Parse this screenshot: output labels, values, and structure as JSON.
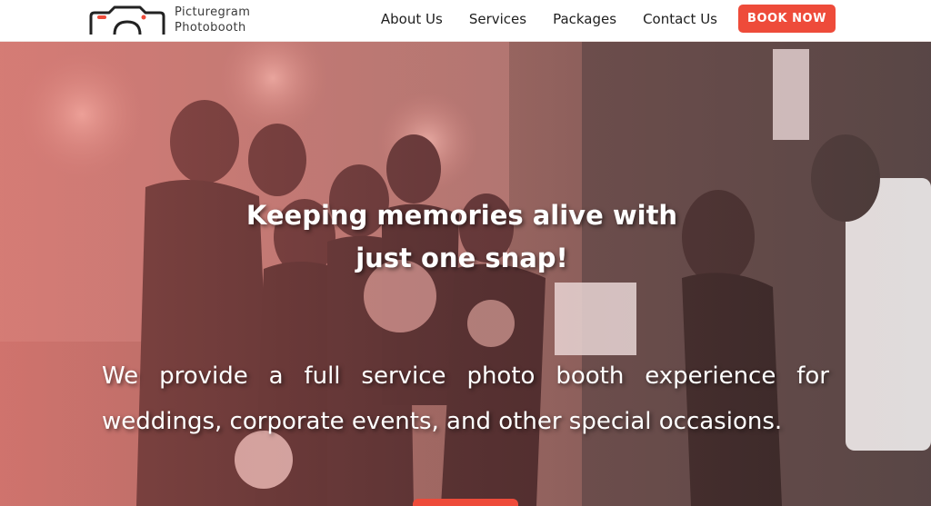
{
  "brand": {
    "name_line1": "Picturegram",
    "name_line2": "Photobooth",
    "accent_color": "#ee4b3a"
  },
  "nav": {
    "items": [
      {
        "label": "About Us"
      },
      {
        "label": "Services"
      },
      {
        "label": "Packages"
      },
      {
        "label": "Contact Us"
      }
    ],
    "cta_label": "BOOK NOW"
  },
  "hero": {
    "headline_line1": "Keeping memories alive with",
    "headline_line2": "just one snap!",
    "subtext_line1_words": [
      "We",
      "provide",
      "a",
      "full",
      "service",
      "photo",
      "booth",
      "experience",
      "for"
    ],
    "subtext_line2": "weddings, corporate events, and other special occasions.",
    "image_subject": "bridesmaids posing at photo booth"
  }
}
